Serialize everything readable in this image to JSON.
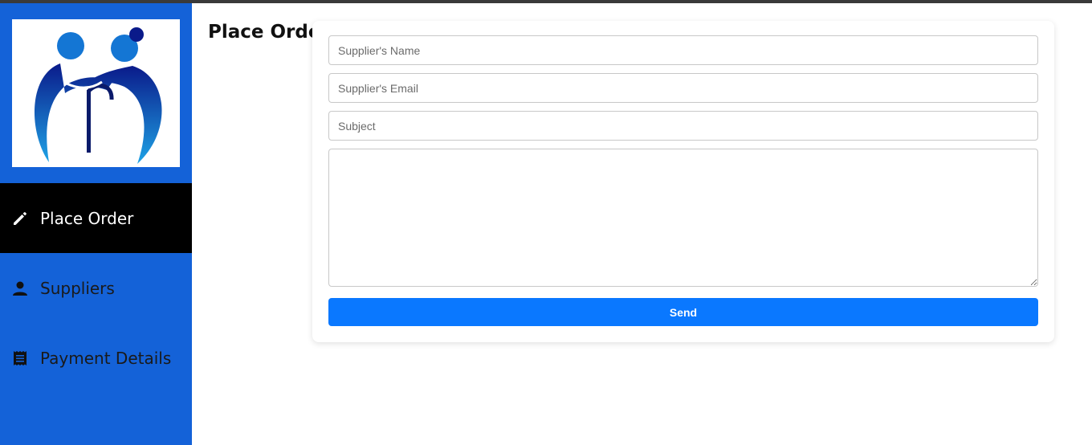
{
  "sidebar": {
    "items": [
      {
        "label": "Place Order",
        "icon": "pencil-icon",
        "active": true
      },
      {
        "label": "Suppliers",
        "icon": "user-icon",
        "active": false
      },
      {
        "label": "Payment Details",
        "icon": "receipt-icon",
        "active": false
      }
    ]
  },
  "main": {
    "title": "Place Order",
    "form": {
      "supplier_name_placeholder": "Supplier's Name",
      "supplier_email_placeholder": "Supplier's Email",
      "subject_placeholder": "Subject",
      "message_placeholder": "",
      "send_label": "Send"
    }
  },
  "colors": {
    "sidebar_bg": "#1462d8",
    "active_item_bg": "#000000",
    "button_bg": "#0a78ff",
    "logo_dark": "#0a1a7a",
    "logo_light": "#1c8de0"
  }
}
